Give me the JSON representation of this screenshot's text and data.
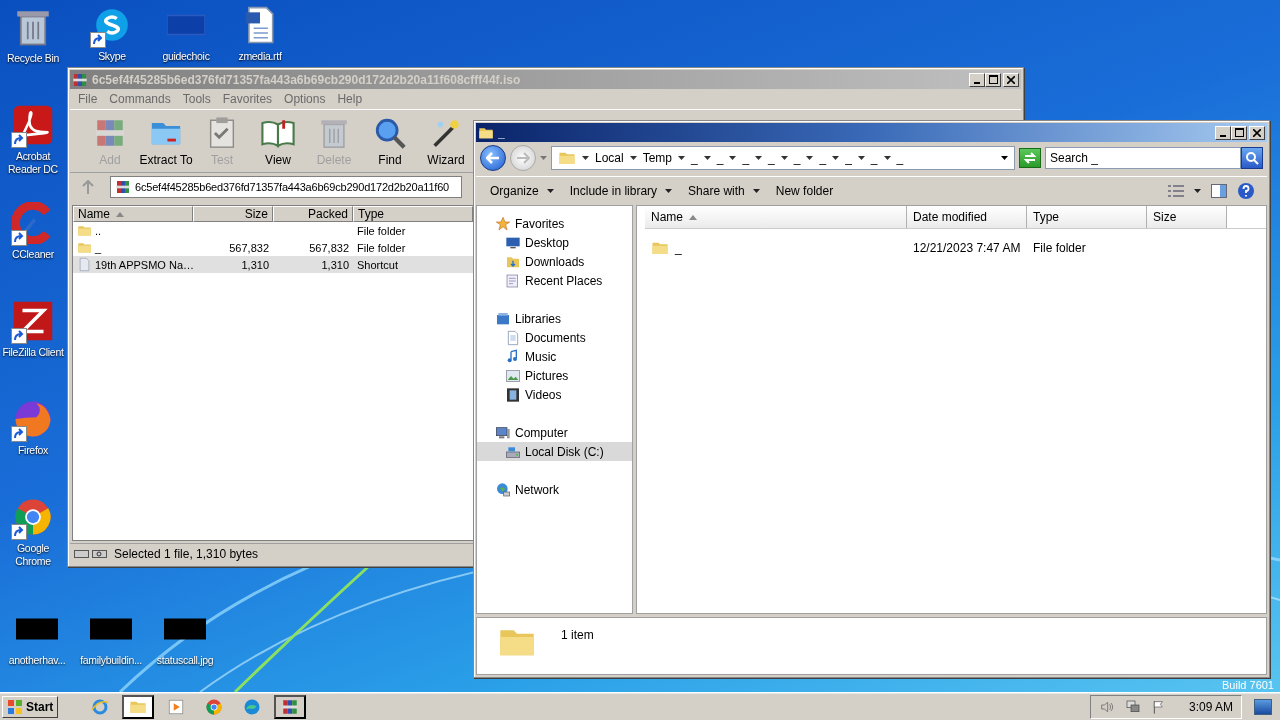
{
  "desktop": {
    "column": [
      {
        "label": "Recycle Bin",
        "kind": "bin",
        "shortcut": false
      },
      {
        "label": "Acrobat Reader DC",
        "kind": "acrobat",
        "shortcut": true
      },
      {
        "label": "CCleaner",
        "kind": "ccleaner",
        "shortcut": true
      },
      {
        "label": "FileZilla Client",
        "kind": "filezilla",
        "shortcut": true
      },
      {
        "label": "Firefox",
        "kind": "firefox",
        "shortcut": true
      },
      {
        "label": "Google Chrome",
        "kind": "chrome",
        "shortcut": true
      }
    ],
    "top_row": [
      {
        "label": "Skype",
        "kind": "skype",
        "shortcut": true
      },
      {
        "label": "guidechoic",
        "kind": "blank",
        "shortcut": false
      },
      {
        "label": "zmedia.rtf",
        "kind": "word",
        "shortcut": false
      }
    ],
    "bottom_row": [
      {
        "label": "anotherhav...",
        "kind": "thumb",
        "shortcut": false
      },
      {
        "label": "familybuildin...",
        "kind": "thumb",
        "shortcut": false
      },
      {
        "label": "statuscall.jpg",
        "kind": "thumb",
        "shortcut": false
      }
    ],
    "build": "Build 7601"
  },
  "winrar": {
    "title": "6c5ef4f45285b6ed376fd71357fa443a6b69cb290d172d2b20a11f608cfff44f.iso",
    "menu": [
      "File",
      "Commands",
      "Tools",
      "Favorites",
      "Options",
      "Help"
    ],
    "toolbar": [
      {
        "label": "Add",
        "kind": "add",
        "disabled": true
      },
      {
        "label": "Extract To",
        "kind": "extract",
        "disabled": false
      },
      {
        "label": "Test",
        "kind": "test",
        "disabled": true
      },
      {
        "label": "View",
        "kind": "view",
        "disabled": false
      },
      {
        "label": "Delete",
        "kind": "delete",
        "disabled": true
      },
      {
        "label": "Find",
        "kind": "find",
        "disabled": false
      },
      {
        "label": "Wizard",
        "kind": "wizard",
        "disabled": false
      }
    ],
    "path": "6c5ef4f45285b6ed376fd71357fa443a6b69cb290d172d2b20a11f60",
    "columns": [
      {
        "label": "Name",
        "sorted": true
      },
      {
        "label": "Size",
        "sorted": false
      },
      {
        "label": "Packed",
        "sorted": false
      },
      {
        "label": "Type",
        "sorted": false
      }
    ],
    "rows": [
      {
        "kind": "folder",
        "name": "..",
        "size": "",
        "packed": "",
        "type": "File folder",
        "selected": false
      },
      {
        "kind": "folder",
        "name": "_",
        "size": "567,832",
        "packed": "567,832",
        "type": "File folder",
        "selected": false
      },
      {
        "kind": "file",
        "name": "19th APPSMO Na…",
        "size": "1,310",
        "packed": "1,310",
        "type": "Shortcut",
        "selected": true
      }
    ],
    "status": "Selected 1 file, 1,310 bytes"
  },
  "explorer": {
    "title": "_",
    "breadcrumb": [
      "Local",
      "Temp",
      "_",
      "_",
      "_",
      "_",
      "_",
      "_",
      "_",
      "_",
      "_"
    ],
    "search": {
      "placeholder": "Search _"
    },
    "commands": [
      {
        "label": "Organize",
        "dropdown": true
      },
      {
        "label": "Include in library",
        "dropdown": true
      },
      {
        "label": "Share with",
        "dropdown": true
      },
      {
        "label": "New folder",
        "dropdown": false
      }
    ],
    "nav": [
      {
        "label": "Favorites",
        "kind": "star",
        "selected": false,
        "children": [
          {
            "label": "Desktop",
            "kind": "monitor",
            "selected": false
          },
          {
            "label": "Downloads",
            "kind": "downloads",
            "selected": false
          },
          {
            "label": "Recent Places",
            "kind": "recent",
            "selected": false
          }
        ]
      },
      {
        "label": "Libraries",
        "kind": "library",
        "selected": false,
        "children": [
          {
            "label": "Documents",
            "kind": "document",
            "selected": false
          },
          {
            "label": "Music",
            "kind": "music",
            "selected": false
          },
          {
            "label": "Pictures",
            "kind": "picture",
            "selected": false
          },
          {
            "label": "Videos",
            "kind": "video",
            "selected": false
          }
        ]
      },
      {
        "label": "Computer",
        "kind": "computer",
        "selected": false,
        "children": [
          {
            "label": "Local Disk (C:)",
            "kind": "drive",
            "selected": true
          }
        ]
      },
      {
        "label": "Network",
        "kind": "network",
        "selected": false
      }
    ],
    "columns": [
      {
        "label": "Name",
        "sorted": true
      },
      {
        "label": "Date modified",
        "sorted": false
      },
      {
        "label": "Type",
        "sorted": false
      },
      {
        "label": "Size",
        "sorted": false
      }
    ],
    "rows": [
      {
        "name": "_",
        "date": "12/21/2023 7:47 AM",
        "type": "File folder"
      }
    ],
    "details": "1 item"
  },
  "taskbar": {
    "start": "Start",
    "items": [
      {
        "kind": "ie",
        "selected": false,
        "open": false
      },
      {
        "kind": "explorer",
        "selected": true,
        "open": true
      },
      {
        "kind": "media",
        "selected": false,
        "open": false
      },
      {
        "kind": "chrome",
        "selected": false,
        "open": false
      },
      {
        "kind": "edge",
        "selected": false,
        "open": false
      },
      {
        "kind": "winrar",
        "selected": false,
        "open": true
      }
    ],
    "clock": "3:09 AM"
  }
}
